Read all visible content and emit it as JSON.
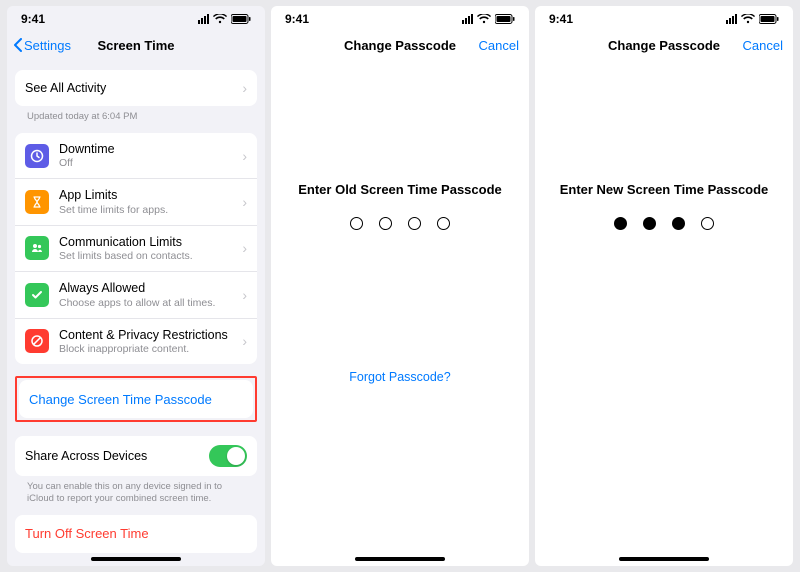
{
  "status": {
    "time": "9:41"
  },
  "screen1": {
    "back": "Settings",
    "title": "Screen Time",
    "see_all": "See All Activity",
    "updated": "Updated today at 6:04 PM",
    "items": [
      {
        "title": "Downtime",
        "sub": "Off",
        "color": "#5e5ce6"
      },
      {
        "title": "App Limits",
        "sub": "Set time limits for apps.",
        "color": "#ff9500"
      },
      {
        "title": "Communication Limits",
        "sub": "Set limits based on contacts.",
        "color": "#34c759"
      },
      {
        "title": "Always Allowed",
        "sub": "Choose apps to allow at all times.",
        "color": "#34c759"
      },
      {
        "title": "Content & Privacy Restrictions",
        "sub": "Block inappropriate content.",
        "color": "#ff3b30"
      }
    ],
    "change_passcode": "Change Screen Time Passcode",
    "share_label": "Share Across Devices",
    "share_note": "You can enable this on any device signed in to iCloud to report your combined screen time.",
    "turn_off": "Turn Off Screen Time"
  },
  "screen2": {
    "title": "Change Passcode",
    "cancel": "Cancel",
    "prompt": "Enter Old Screen Time Passcode",
    "filled": [
      false,
      false,
      false,
      false
    ],
    "forgot": "Forgot Passcode?"
  },
  "screen3": {
    "title": "Change Passcode",
    "cancel": "Cancel",
    "prompt": "Enter New Screen Time Passcode",
    "filled": [
      true,
      true,
      true,
      false
    ]
  }
}
